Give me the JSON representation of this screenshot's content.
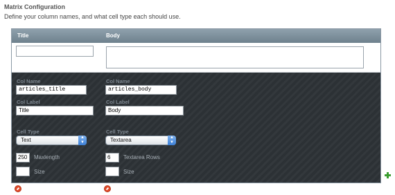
{
  "header": {
    "title": "Matrix Configuration",
    "description": "Define your column names, and what cell type each should use."
  },
  "columns": [
    {
      "header": "Title",
      "col_name_label": "Col Name",
      "col_name_value": "articles_title",
      "col_label_label": "Col Label",
      "col_label_value": "Title",
      "cell_type_label": "Cell Type",
      "cell_type_value": "Text",
      "setting1_value": "250",
      "setting1_label": "Maxlength",
      "setting2_value": "",
      "setting2_label": "Size"
    },
    {
      "header": "Body",
      "col_name_label": "Col Name",
      "col_name_value": "articles_body",
      "col_label_label": "Col Label",
      "col_label_value": "Body",
      "cell_type_label": "Cell Type",
      "cell_type_value": "Textarea",
      "setting1_value": "6",
      "setting1_label": "Textarea Rows",
      "setting2_value": "",
      "setting2_label": "Size"
    }
  ],
  "icons": {
    "delete": "delete-icon",
    "add": "add-icon",
    "select_arrow": "select-arrows-icon"
  },
  "colors": {
    "header_bar": "#7d8f9b",
    "settings_bg": "#2c3135",
    "delete_red": "#e04a2a",
    "add_green": "#3a9d2f",
    "select_blue": "#3c7fd6"
  }
}
